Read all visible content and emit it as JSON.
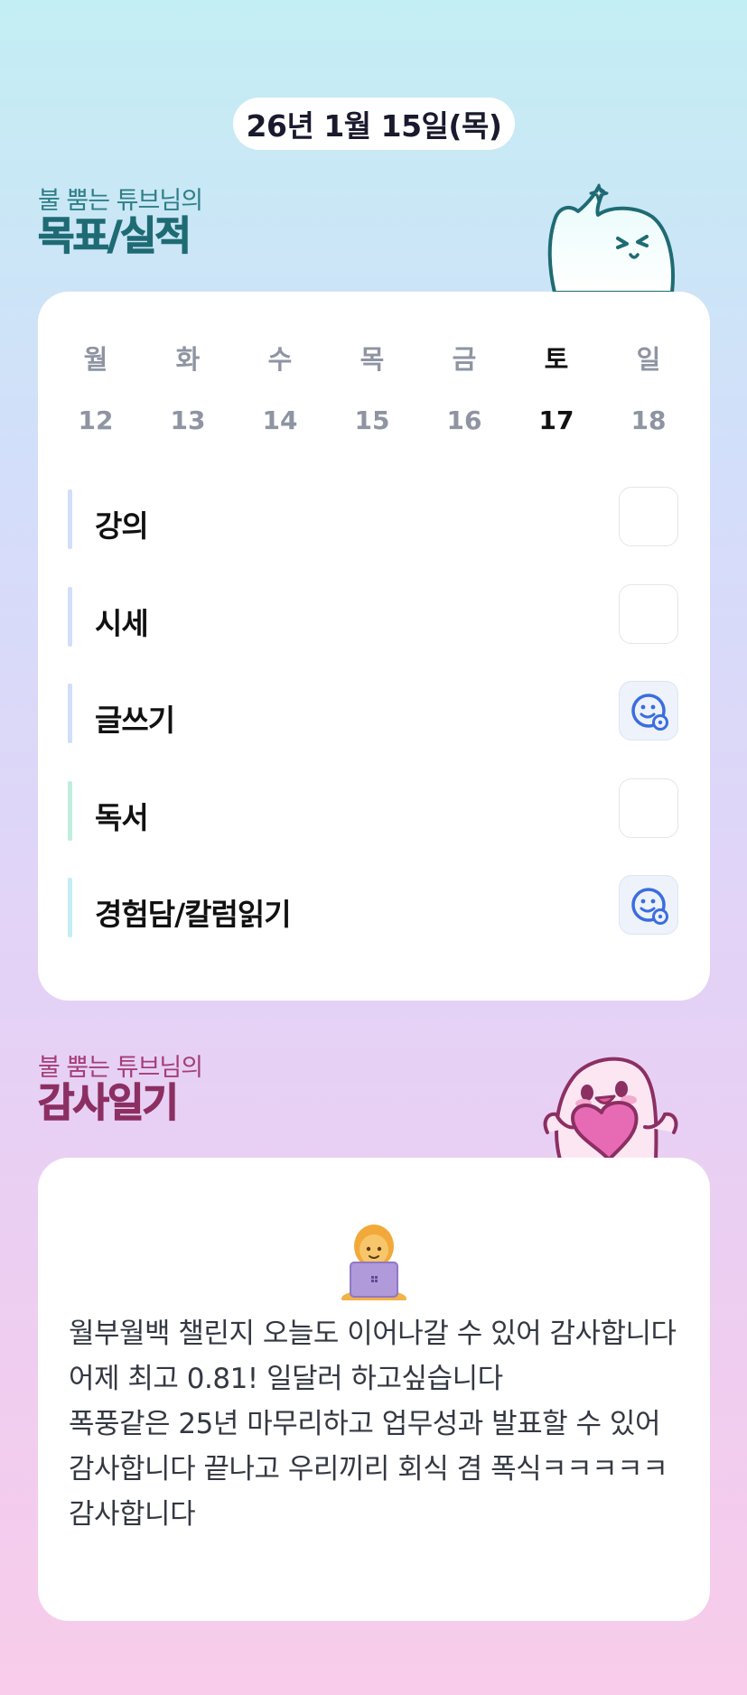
{
  "header": {
    "date": "26년 1월 15일(목)"
  },
  "goals_section": {
    "subtitle": "불 뿜는 튜브님의",
    "title": "목표/실적"
  },
  "week": [
    {
      "dayname": "월",
      "date": "12",
      "active": false
    },
    {
      "dayname": "화",
      "date": "13",
      "active": false
    },
    {
      "dayname": "수",
      "date": "14",
      "active": false
    },
    {
      "dayname": "목",
      "date": "15",
      "active": false
    },
    {
      "dayname": "금",
      "date": "16",
      "active": false
    },
    {
      "dayname": "토",
      "date": "17",
      "active": true
    },
    {
      "dayname": "일",
      "date": "18",
      "active": false
    }
  ],
  "goals": [
    {
      "label": "강의",
      "done": false,
      "bar_color": "#d3def7"
    },
    {
      "label": "시세",
      "done": false,
      "bar_color": "#d3def7"
    },
    {
      "label": "글쓰기",
      "done": true,
      "bar_color": "#d3def7"
    },
    {
      "label": "독서",
      "done": false,
      "bar_color": "#bfeede"
    },
    {
      "label": "경험담/칼럼읽기",
      "done": true,
      "bar_color": "#c3eef3"
    }
  ],
  "gratitude_section": {
    "subtitle": "불 뿜는 튜브님의",
    "title": "감사일기"
  },
  "gratitude": {
    "emoji": "woman-technologist",
    "text": "월부월백 챌린지 오늘도 이어나갈 수 있어 감사합니다\n어제 최고 0.81! 일달러 하고싶습니다\n폭풍같은 25년 마무리하고 업무성과 발표할 수 있어 감사합니다 끝나고 우리끼리 회식 겸 폭식ㅋㅋㅋㅋㅋ 감사합니다"
  },
  "colors": {
    "check_icon": "#3b6de0",
    "goals_title": "#1f6b74",
    "gratitude_title": "#8c2f63"
  }
}
